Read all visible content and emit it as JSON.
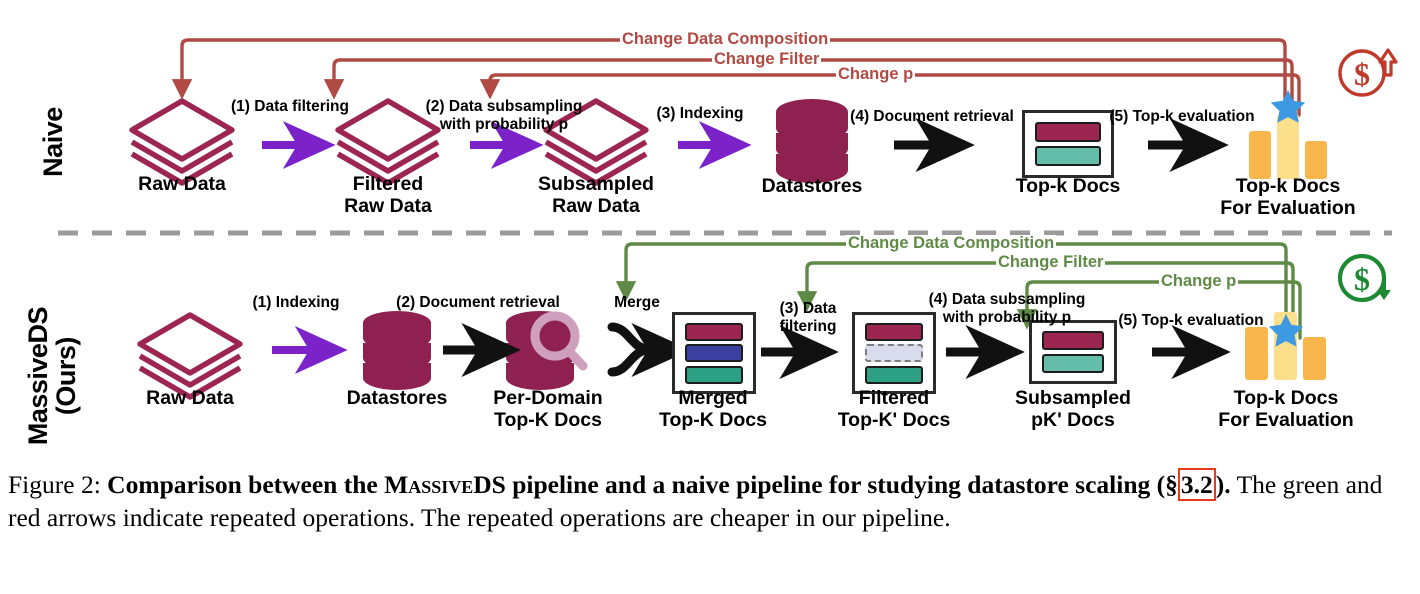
{
  "figure": {
    "caption_prefix": "Figure 2:",
    "caption_bold_1": "Comparison between the ",
    "caption_smallcaps": "MassiveDS",
    "caption_bold_2": " pipeline and a naive pipeline for studying datastore scaling (§",
    "caption_secref": "3.2",
    "caption_bold_3": ").",
    "caption_rest": "The green and red arrows indicate repeated operations.  The repeated operations are cheaper in our pipeline."
  },
  "colors": {
    "maroon": "#9c2552",
    "maroon_dark": "#8e2150",
    "purple_arrow": "#7b22c9",
    "black_arrow": "#111111",
    "red_loop": "#b04a43",
    "green_loop": "#5f8a46",
    "teal": "#63bda9",
    "teal_dark": "#2ea083",
    "indigo": "#3b3fa0",
    "orange_bar": "#f8b64c",
    "yellow_bar": "#fbdf8a",
    "star_blue": "#3d9ae2",
    "check_green": "#48b95a",
    "cross_red": "#e04452",
    "magnifier": "#cfa0bd",
    "divider_gray": "#9b9b9b",
    "filtered_out": "#d9dcec"
  },
  "rows": [
    {
      "id": "naive",
      "side_label": "Naive",
      "cost_icon": {
        "name": "money-up-icon",
        "symbol": "$",
        "direction": "up",
        "color": "#c0392b"
      },
      "stages": [
        {
          "id": "raw-data",
          "label": "Raw Data",
          "icon": "stacked-diamonds-icon"
        },
        {
          "id": "filtered-raw",
          "label": "Filtered\nRaw Data",
          "icon": "stacked-diamonds-icon"
        },
        {
          "id": "subsampled-raw",
          "label": "Subsampled\nRaw Data",
          "icon": "stacked-diamonds-icon"
        },
        {
          "id": "datastores",
          "label": "Datastores",
          "icon": "database-icon"
        },
        {
          "id": "topk-docs",
          "label": "Top-k Docs",
          "icon": "doc-list-icon"
        },
        {
          "id": "topk-docs-eval",
          "label": "Top-k Docs\nFor Evaluation",
          "icon": "bar-chart-star-icon"
        }
      ],
      "steps": [
        {
          "id": "step-1",
          "label": "(1) Data filtering",
          "arrow": "purple"
        },
        {
          "id": "step-2",
          "label": "(2) Data subsampling\nwith probability p",
          "arrow": "purple"
        },
        {
          "id": "step-3",
          "label": "(3) Indexing",
          "arrow": "purple"
        },
        {
          "id": "step-4",
          "label": "(4) Document retrieval",
          "arrow": "black"
        },
        {
          "id": "step-5",
          "label": "(5) Top-k evaluation",
          "arrow": "black"
        }
      ],
      "loops": [
        {
          "id": "loop-change-data-composition",
          "label": "Change Data Composition"
        },
        {
          "id": "loop-change-filter",
          "label": "Change Filter"
        },
        {
          "id": "loop-change-p",
          "label": "Change p"
        }
      ]
    },
    {
      "id": "massiveds",
      "side_label": "MassiveDS\n(Ours)",
      "cost_icon": {
        "name": "money-down-icon",
        "symbol": "$",
        "direction": "down",
        "color": "#1d8a33"
      },
      "stages": [
        {
          "id": "raw-data",
          "label": "Raw Data",
          "icon": "stacked-diamonds-icon"
        },
        {
          "id": "datastores",
          "label": "Datastores",
          "icon": "database-icon"
        },
        {
          "id": "per-domain-topk",
          "label": "Per-Domain\nTop-K Docs",
          "icon": "database-search-icon"
        },
        {
          "id": "merged-topk",
          "label": "Merged\nTop-K Docs",
          "icon": "doc-list-icon"
        },
        {
          "id": "filtered-topk",
          "label": "Filtered\nTop-K' Docs",
          "icon": "doc-list-check-icon"
        },
        {
          "id": "subsampled-pk",
          "label": "Subsampled\npK' Docs",
          "icon": "doc-list-icon"
        },
        {
          "id": "topk-docs-eval",
          "label": "Top-k Docs\nFor Evaluation",
          "icon": "bar-chart-star-icon"
        }
      ],
      "steps": [
        {
          "id": "step-1",
          "label": "(1) Indexing",
          "arrow": "purple"
        },
        {
          "id": "step-2",
          "label": "(2) Document retrieval",
          "arrow": "black"
        },
        {
          "id": "step-merge",
          "label": "Merge",
          "arrow": "merge"
        },
        {
          "id": "step-3",
          "label": "(3) Data\nfiltering",
          "arrow": "black"
        },
        {
          "id": "step-4",
          "label": "(4) Data subsampling\nwith probability p",
          "arrow": "black"
        },
        {
          "id": "step-5",
          "label": "(5) Top-k evaluation",
          "arrow": "black"
        }
      ],
      "loops": [
        {
          "id": "loop-change-data-composition",
          "label": "Change Data Composition"
        },
        {
          "id": "loop-change-filter",
          "label": "Change Filter"
        },
        {
          "id": "loop-change-p",
          "label": "Change p"
        }
      ]
    }
  ]
}
